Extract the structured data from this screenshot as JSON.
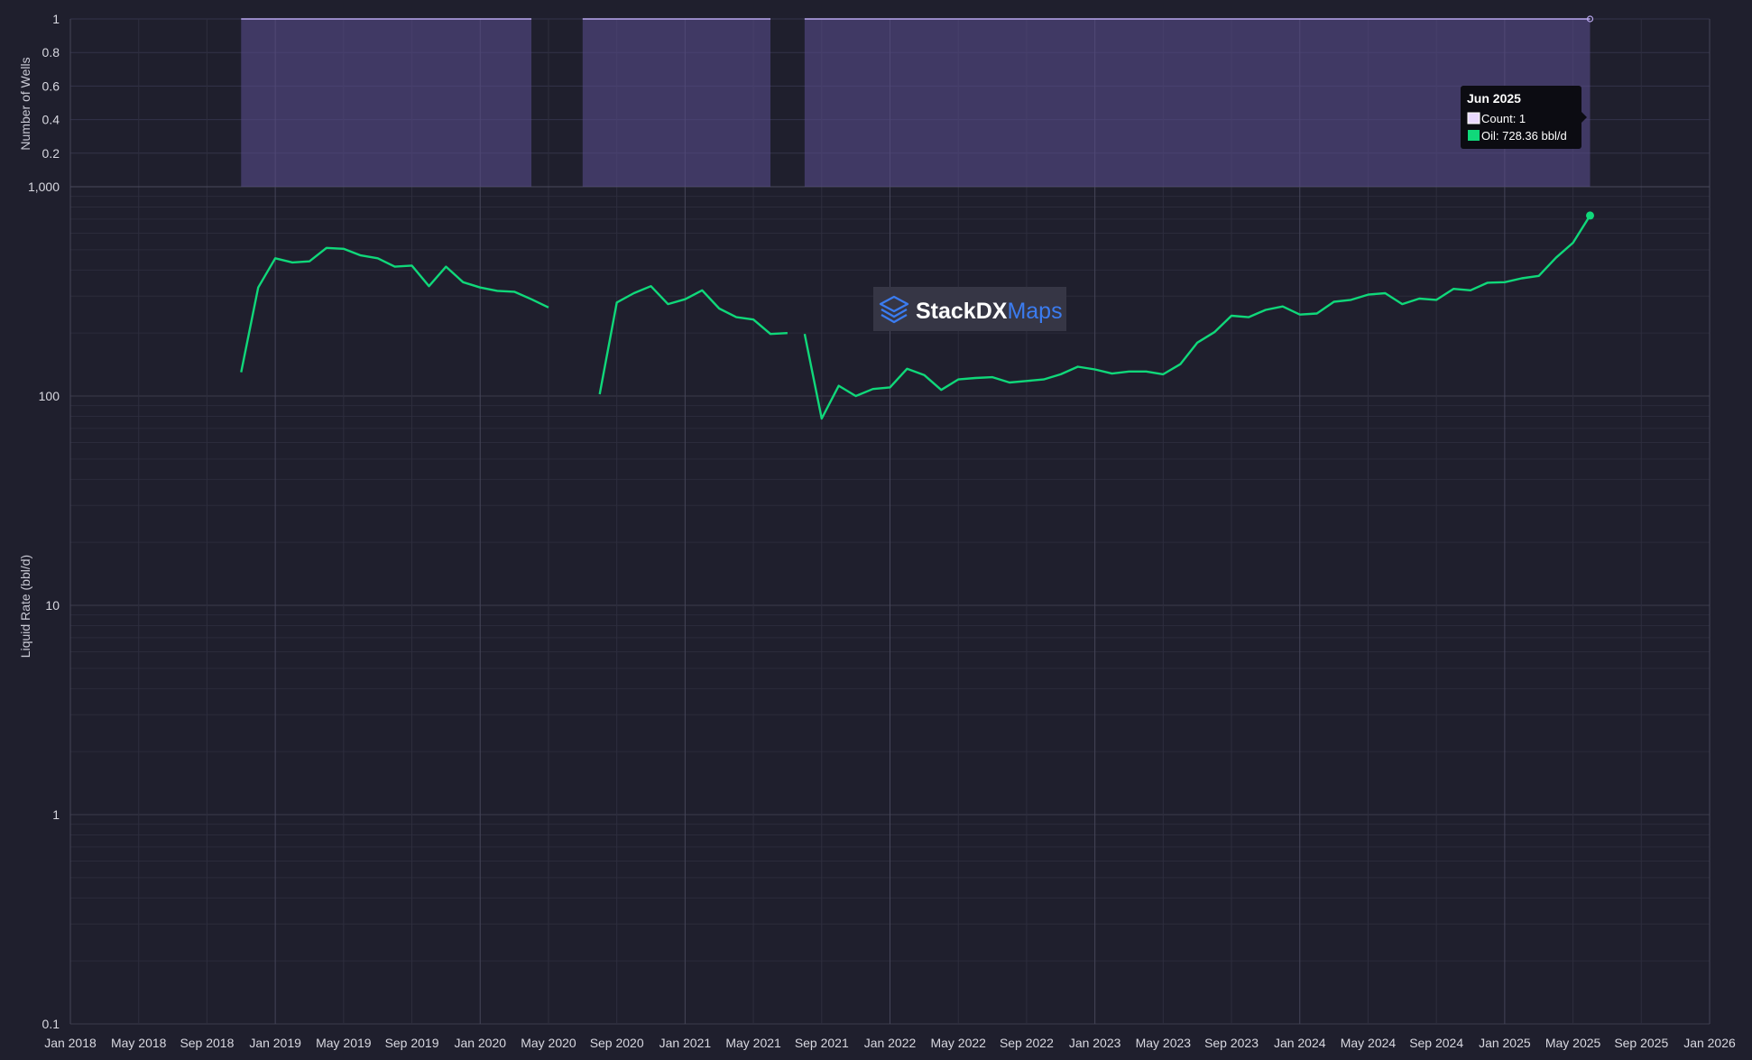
{
  "chart_data": [
    {
      "type": "area",
      "ylabel": "Number of Wells",
      "ylim": [
        0,
        1
      ],
      "y_ticks": [
        "0.2",
        "0.4",
        "0.6",
        "0.8",
        "1"
      ],
      "series": [
        {
          "name": "Count",
          "color": "#b9a7ee",
          "segments": [
            {
              "start": "2018-11",
              "end": "2020-04",
              "value": 1
            },
            {
              "start": "2020-07",
              "end": "2021-06",
              "value": 1
            },
            {
              "start": "2021-08",
              "end": "2025-06",
              "value": 1
            }
          ]
        }
      ]
    },
    {
      "type": "line",
      "ylabel": "Liquid Rate (bbl/d)",
      "yscale": "log",
      "ylim": [
        0.1,
        1000
      ],
      "y_ticks": [
        "0.1",
        "1",
        "10",
        "100",
        "1,000"
      ],
      "xlim": [
        "2018-01",
        "2026-01"
      ],
      "x_ticks": [
        "Jan 2018",
        "May 2018",
        "Sep 2018",
        "Jan 2019",
        "May 2019",
        "Sep 2019",
        "Jan 2020",
        "May 2020",
        "Sep 2020",
        "Jan 2021",
        "May 2021",
        "Sep 2021",
        "Jan 2022",
        "May 2022",
        "Sep 2022",
        "Jan 2023",
        "May 2023",
        "Sep 2023",
        "Jan 2024",
        "May 2024",
        "Sep 2024",
        "Jan 2025",
        "May 2025",
        "Sep 2025",
        "Jan 2026"
      ],
      "grid": true,
      "series": [
        {
          "name": "Oil",
          "color": "#10d87a",
          "segments": [
            [
              {
                "x": "2018-11",
                "y": 130
              },
              {
                "x": "2018-12",
                "y": 330
              },
              {
                "x": "2019-01",
                "y": 455
              },
              {
                "x": "2019-02",
                "y": 435
              },
              {
                "x": "2019-03",
                "y": 440
              },
              {
                "x": "2019-04",
                "y": 510
              },
              {
                "x": "2019-05",
                "y": 505
              },
              {
                "x": "2019-06",
                "y": 470
              },
              {
                "x": "2019-07",
                "y": 455
              },
              {
                "x": "2019-08",
                "y": 415
              },
              {
                "x": "2019-09",
                "y": 420
              },
              {
                "x": "2019-10",
                "y": 335
              },
              {
                "x": "2019-11",
                "y": 415
              },
              {
                "x": "2019-12",
                "y": 350
              },
              {
                "x": "2020-01",
                "y": 330
              },
              {
                "x": "2020-02",
                "y": 318
              },
              {
                "x": "2020-03",
                "y": 315
              },
              {
                "x": "2020-04",
                "y": 290
              },
              {
                "x": "2020-05",
                "y": 265
              }
            ],
            [
              {
                "x": "2020-08",
                "y": 102
              },
              {
                "x": "2020-09",
                "y": 280
              },
              {
                "x": "2020-10",
                "y": 310
              },
              {
                "x": "2020-11",
                "y": 335
              },
              {
                "x": "2020-12",
                "y": 275
              },
              {
                "x": "2021-01",
                "y": 290
              },
              {
                "x": "2021-02",
                "y": 320
              },
              {
                "x": "2021-03",
                "y": 262
              },
              {
                "x": "2021-04",
                "y": 238
              },
              {
                "x": "2021-05",
                "y": 232
              },
              {
                "x": "2021-06",
                "y": 198
              },
              {
                "x": "2021-07",
                "y": 200
              }
            ],
            [
              {
                "x": "2021-08",
                "y": 198
              },
              {
                "x": "2021-09",
                "y": 78
              },
              {
                "x": "2021-10",
                "y": 112
              },
              {
                "x": "2021-11",
                "y": 100
              },
              {
                "x": "2021-12",
                "y": 108
              },
              {
                "x": "2022-01",
                "y": 110
              },
              {
                "x": "2022-02",
                "y": 135
              },
              {
                "x": "2022-03",
                "y": 126
              },
              {
                "x": "2022-04",
                "y": 107
              },
              {
                "x": "2022-05",
                "y": 120
              },
              {
                "x": "2022-06",
                "y": 122
              },
              {
                "x": "2022-07",
                "y": 123
              },
              {
                "x": "2022-08",
                "y": 116
              },
              {
                "x": "2022-09",
                "y": 118
              },
              {
                "x": "2022-10",
                "y": 120
              },
              {
                "x": "2022-11",
                "y": 127
              },
              {
                "x": "2022-12",
                "y": 138
              },
              {
                "x": "2023-01",
                "y": 134
              },
              {
                "x": "2023-02",
                "y": 128
              },
              {
                "x": "2023-03",
                "y": 131
              },
              {
                "x": "2023-04",
                "y": 131
              },
              {
                "x": "2023-05",
                "y": 127
              },
              {
                "x": "2023-06",
                "y": 142
              },
              {
                "x": "2023-07",
                "y": 180
              },
              {
                "x": "2023-08",
                "y": 202
              },
              {
                "x": "2023-09",
                "y": 242
              },
              {
                "x": "2023-10",
                "y": 238
              },
              {
                "x": "2023-11",
                "y": 258
              },
              {
                "x": "2023-12",
                "y": 268
              },
              {
                "x": "2024-01",
                "y": 245
              },
              {
                "x": "2024-02",
                "y": 248
              },
              {
                "x": "2024-03",
                "y": 282
              },
              {
                "x": "2024-04",
                "y": 288
              },
              {
                "x": "2024-05",
                "y": 305
              },
              {
                "x": "2024-06",
                "y": 310
              },
              {
                "x": "2024-07",
                "y": 275
              },
              {
                "x": "2024-08",
                "y": 292
              },
              {
                "x": "2024-09",
                "y": 288
              },
              {
                "x": "2024-10",
                "y": 325
              },
              {
                "x": "2024-11",
                "y": 320
              },
              {
                "x": "2024-12",
                "y": 348
              },
              {
                "x": "2025-01",
                "y": 350
              },
              {
                "x": "2025-02",
                "y": 365
              },
              {
                "x": "2025-03",
                "y": 375
              },
              {
                "x": "2025-04",
                "y": 458
              },
              {
                "x": "2025-05",
                "y": 540
              },
              {
                "x": "2025-06",
                "y": 728.36
              }
            ]
          ]
        }
      ]
    }
  ],
  "tooltip": {
    "title": "Jun 2025",
    "count_label": "Count: 1",
    "oil_label": "Oil: 728.36 bbl/d"
  },
  "watermark": {
    "brand": "StackDX",
    "product": "Maps"
  }
}
